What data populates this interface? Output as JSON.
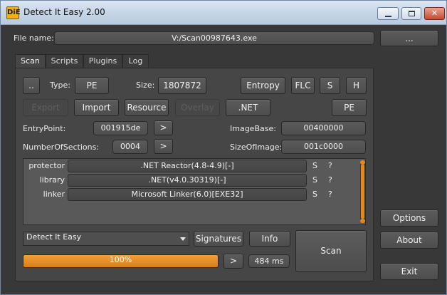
{
  "window": {
    "title": "Detect It Easy 2.00",
    "app_icon_text": "DiE",
    "minimize_icon": "minimize-icon",
    "maximize_icon": "maximize-icon",
    "close_icon": "close-icon",
    "close_glyph": "✕"
  },
  "file": {
    "label": "File name:",
    "value": "V:/Scan00987643.exe",
    "browse_label": "..."
  },
  "tabs": [
    {
      "label": "Scan",
      "active": true
    },
    {
      "label": "Scripts",
      "active": false
    },
    {
      "label": "Plugins",
      "active": false
    },
    {
      "label": "Log",
      "active": false
    }
  ],
  "scan": {
    "up_label": "..",
    "type_label": "Type:",
    "type_value": "PE",
    "size_label": "Size:",
    "size_value": "1807872",
    "entropy_label": "Entropy",
    "flc_label": "FLC",
    "s_label": "S",
    "h_label": "H",
    "export_label": "Export",
    "import_label": "Import",
    "resource_label": "Resource",
    "overlay_label": "Overlay",
    "net_label": ".NET",
    "pe_label": "PE",
    "entrypoint_label": "EntryPoint:",
    "entrypoint_value": "001915de",
    "imagebase_label": "ImageBase:",
    "imagebase_value": "00400000",
    "numsections_label": "NumberOfSections:",
    "numsections_value": "0004",
    "sizeofimage_label": "SizeOfImage:",
    "sizeofimage_value": "001c0000",
    "arrow_label": ">"
  },
  "results": [
    {
      "type": "protector",
      "value": ".NET Reactor(4.8-4.9)[-]",
      "s": "S",
      "q": "?"
    },
    {
      "type": "library",
      "value": ".NET(v4.0.30319)[-]",
      "s": "S",
      "q": "?"
    },
    {
      "type": "linker",
      "value": "Microsoft Linker(6.0)[EXE32]",
      "s": "S",
      "q": "?"
    }
  ],
  "bottom": {
    "database_value": "Detect It Easy",
    "signatures_label": "Signatures",
    "info_label": "Info",
    "scan_label": "Scan",
    "progress_text": "100%",
    "progress_fraction": 1.0,
    "next_label": ">",
    "time_text": "484 ms"
  },
  "side": {
    "options_label": "Options",
    "about_label": "About",
    "exit_label": "Exit"
  },
  "colors": {
    "accent": "#e3891b",
    "background": "#383838",
    "panel": "#464646"
  }
}
